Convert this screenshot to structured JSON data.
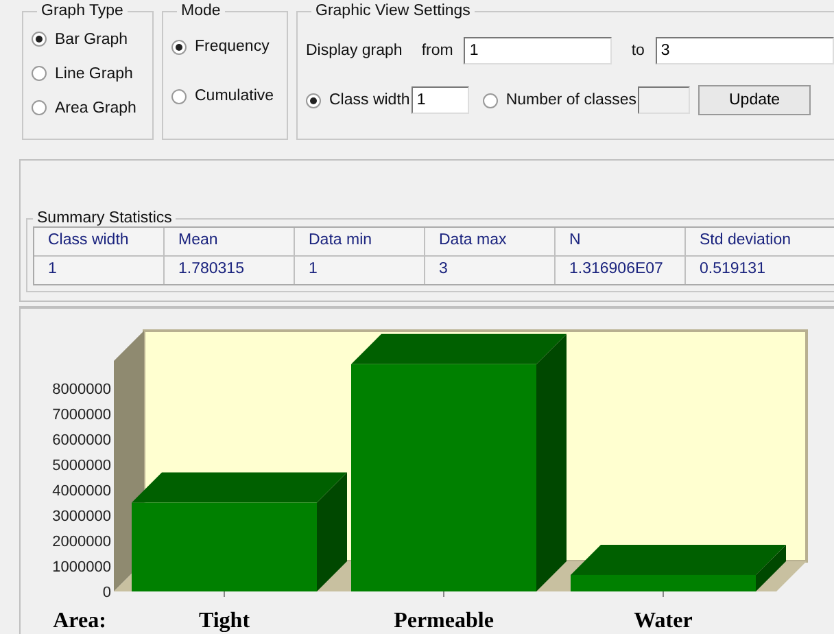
{
  "graph_type": {
    "title": "Graph Type",
    "options": [
      {
        "label": "Bar Graph",
        "selected": true
      },
      {
        "label": "Line Graph",
        "selected": false
      },
      {
        "label": "Area Graph",
        "selected": false
      }
    ]
  },
  "mode": {
    "title": "Mode",
    "options": [
      {
        "label": "Frequency",
        "selected": true
      },
      {
        "label": "Cumulative",
        "selected": false
      }
    ]
  },
  "view_settings": {
    "title": "Graphic View Settings",
    "display_label": "Display graph",
    "from_label": "from",
    "from_value": "1",
    "to_label": "to",
    "to_value": "3",
    "class_width": {
      "label": "Class width",
      "value": "1",
      "selected": true
    },
    "number_of_classes": {
      "label": "Number of classes",
      "selected": false
    },
    "update_button": "Update"
  },
  "summary": {
    "title": "Summary Statistics",
    "columns": [
      "Class width",
      "Mean",
      "Data min",
      "Data max",
      "N",
      "Std deviation"
    ],
    "rows": [
      [
        "1",
        "1.780315",
        "1",
        "3",
        "1.316906E07",
        "0.519131"
      ]
    ]
  },
  "chart": {
    "x_title": "Area:",
    "chart_data": {
      "type": "bar",
      "categories": [
        "Tight",
        "Permeable",
        "Water"
      ],
      "values": [
        3500000,
        8950000,
        650000
      ],
      "ylim": [
        0,
        9000000
      ],
      "yticks": [
        0,
        1000000,
        2000000,
        3000000,
        4000000,
        5000000,
        6000000,
        7000000,
        8000000
      ]
    }
  }
}
